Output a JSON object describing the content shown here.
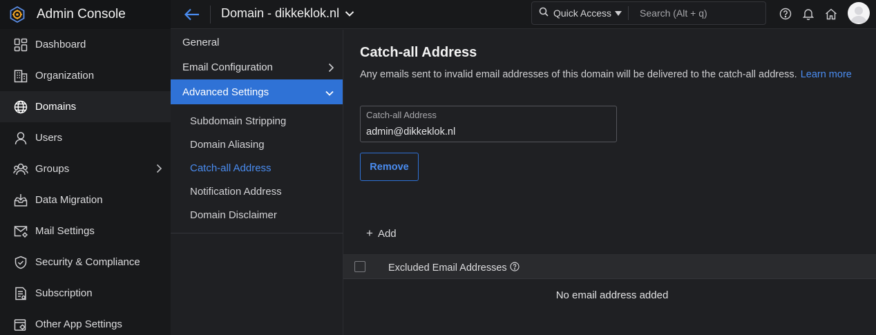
{
  "app": {
    "title": "Admin Console"
  },
  "sidebar": {
    "items": [
      {
        "label": "Dashboard",
        "icon": "dashboard-icon"
      },
      {
        "label": "Organization",
        "icon": "building-icon"
      },
      {
        "label": "Domains",
        "icon": "globe-icon",
        "active": true
      },
      {
        "label": "Users",
        "icon": "user-icon"
      },
      {
        "label": "Groups",
        "icon": "groups-icon",
        "expandable": true
      },
      {
        "label": "Data Migration",
        "icon": "inbox-import-icon"
      },
      {
        "label": "Mail Settings",
        "icon": "mail-settings-icon"
      },
      {
        "label": "Security & Compliance",
        "icon": "shield-icon"
      },
      {
        "label": "Subscription",
        "icon": "document-icon"
      },
      {
        "label": "Other App Settings",
        "icon": "apps-settings-icon"
      }
    ]
  },
  "topbar": {
    "page_title": "Domain - dikkeklok.nl",
    "quick_access": "Quick Access",
    "search_placeholder": "Search (Alt + q)"
  },
  "subnav": {
    "general": "General",
    "email_configuration": "Email Configuration",
    "advanced_settings": "Advanced Settings",
    "children": [
      "Subdomain Stripping",
      "Domain Aliasing",
      "Catch-all Address",
      "Notification Address",
      "Domain Disclaimer"
    ],
    "selected_child": "Catch-all Address"
  },
  "main": {
    "title": "Catch-all Address",
    "description": "Any emails sent to invalid email addresses of this domain will be delivered to the catch-all address.",
    "learn_more": "Learn more",
    "field_label": "Catch-all Address",
    "field_value": "admin@dikkeklok.nl",
    "remove_label": "Remove",
    "add_label": "Add",
    "table_header": "Excluded Email Addresses",
    "empty_message": "No email address added"
  },
  "colors": {
    "accent": "#2f72d6",
    "link": "#4a8cf0",
    "logo": "#f5a623"
  }
}
